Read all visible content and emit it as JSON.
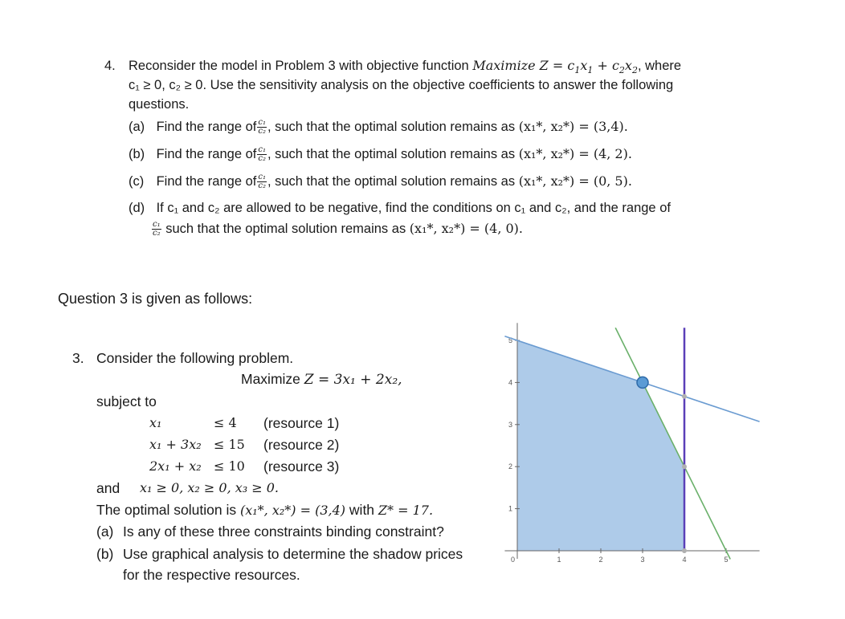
{
  "problem4": {
    "number": "4.",
    "intro_line1_a": "Reconsider the model in Problem 3 with objective function",
    "intro_line1_b": "Maximize Z = c",
    "intro_line1_c": "x",
    "intro_line1_d": " + c",
    "intro_line1_e": "x",
    "intro_line1_f": ", where",
    "intro_line2": "c₁ ≥ 0, c₂ ≥ 0. Use the sensitivity analysis on the objective coefficients to answer the following",
    "intro_line3": "questions.",
    "parts": [
      {
        "label": "(a)",
        "prefix": "Find the range of",
        "suffix": ", such that the optimal solution remains as",
        "solution": "(x₁*, x₂*) = (3,4)."
      },
      {
        "label": "(b)",
        "prefix": "Find the range of",
        "suffix": ", such that the optimal solution remains as",
        "solution": "(x₁*, x₂*) = (4, 2)."
      },
      {
        "label": "(c)",
        "prefix": "Find the range of",
        "suffix": ", such that the optimal solution remains as",
        "solution": "(x₁*, x₂*) = (0, 5)."
      },
      {
        "label": "(d)",
        "line1": "If c₁ and c₂ are allowed to be negative, find the conditions on c₁ and c₂, and the range of",
        "line2": "such that the optimal solution remains as",
        "solution": "(x₁*, x₂*) = (4, 0)."
      }
    ],
    "fraction": {
      "num": "c₁",
      "den": "c₂"
    }
  },
  "intro": "Question 3 is given as follows:",
  "problem3": {
    "number": "3.",
    "title": "Consider the following problem.",
    "objective_word": "Maximize",
    "objective": "Z = 3x₁ + 2x₂,",
    "subject_to": "subject to",
    "constraints": [
      {
        "lhs": "x₁",
        "rhs": "≤ 4",
        "label": "(resource 1)"
      },
      {
        "lhs": "x₁ + 3x₂",
        "rhs": "≤ 15",
        "label": "(resource 2)"
      },
      {
        "lhs": "2x₁ + x₂",
        "rhs": "≤ 10",
        "label": "(resource 3)"
      }
    ],
    "nonneg_word": "and",
    "nonneg": "x₁ ≥ 0,  x₂ ≥ 0, x₃ ≥ 0.",
    "optimal_prefix": "The optimal solution is",
    "optimal_value": "(x₁*, x₂*) = (3,4)",
    "optimal_with": "with",
    "optimal_z": "Z* = 17.",
    "questions": [
      {
        "label": "(a)",
        "text": "Is any of these three constraints binding constraint?"
      },
      {
        "label": "(b)",
        "text": "Use graphical analysis to determine the shadow prices",
        "text2": "for the respective resources."
      }
    ]
  },
  "chart_data": {
    "type": "line",
    "title": "",
    "xlabel": "",
    "ylabel": "",
    "xlim": [
      -0.3,
      5.8
    ],
    "ylim": [
      0,
      5.3
    ],
    "x_ticks": [
      "0",
      "1",
      "2",
      "3",
      "4",
      "5"
    ],
    "y_ticks": [
      "1",
      "2",
      "3",
      "4",
      "5"
    ],
    "grid": false,
    "feasible_region": [
      [
        0,
        0
      ],
      [
        0,
        5
      ],
      [
        3,
        4
      ],
      [
        4,
        2
      ],
      [
        4,
        0
      ]
    ],
    "feasible_color": "#aecbe9",
    "series": [
      {
        "name": "x1 + 3x2 = 15",
        "color": "#6a9bd1",
        "points": [
          [
            -0.3,
            5.1
          ],
          [
            5.8,
            3.07
          ]
        ]
      },
      {
        "name": "2x1 + x2 = 10",
        "color": "#6ab06a",
        "points": [
          [
            2.35,
            5.3
          ],
          [
            5.1,
            -0.2
          ]
        ]
      },
      {
        "name": "x1 = 4",
        "color": "#5a3fb8",
        "points": [
          [
            4,
            0
          ],
          [
            4,
            5.3
          ]
        ]
      }
    ],
    "optimal_point": {
      "x": 3,
      "y": 4,
      "color": "#5b9bd5"
    },
    "intersection_points": [
      [
        4,
        3.67
      ],
      [
        4,
        2
      ],
      [
        4,
        0
      ]
    ]
  }
}
